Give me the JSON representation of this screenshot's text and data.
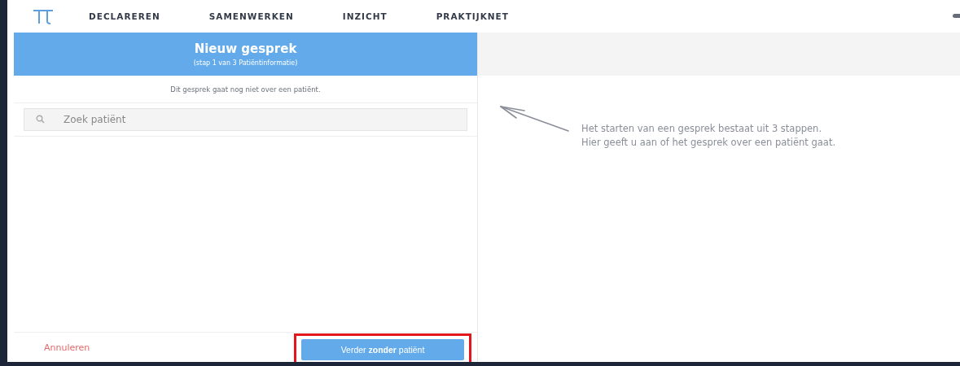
{
  "nav": {
    "items": [
      {
        "label": "DECLAREREN"
      },
      {
        "label": "SAMENWERKEN"
      },
      {
        "label": "INZICHT"
      },
      {
        "label": "PRAKTIJKNET"
      }
    ]
  },
  "dialog": {
    "title": "Nieuw gesprek",
    "subtitle": "(stap 1 van 3 Patiëntinformatie)",
    "notice": "Dit gesprek gaat nog niet over een patiënt.",
    "search": {
      "placeholder": "Zoek patiënt"
    },
    "cancel": "Annuleren",
    "continue": "Verder **zonder** patiënt",
    "continue_highlighted": true
  },
  "hint": {
    "lines": [
      "Het starten van een gesprek bestaat uit 3 stappen.",
      "Hier geeft u aan of het gesprek over een patiënt gaat."
    ]
  }
}
